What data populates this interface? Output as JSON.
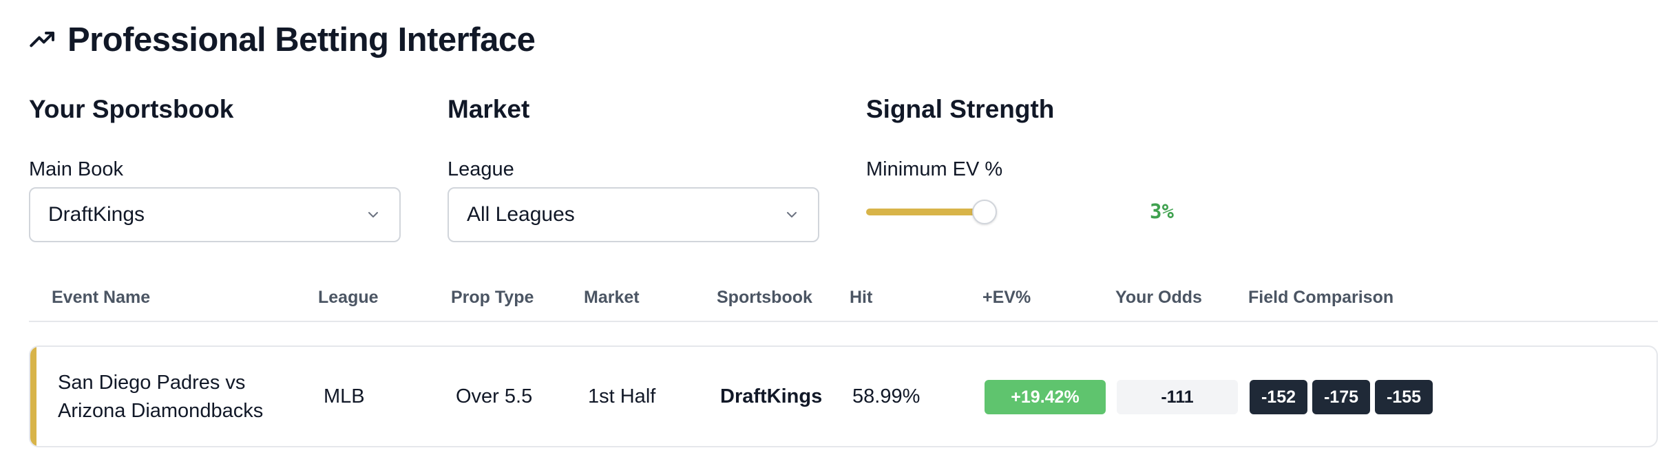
{
  "header": {
    "title": "Professional Betting Interface",
    "icon": "trending-up-icon"
  },
  "sections": {
    "sportsbook": {
      "heading": "Your Sportsbook",
      "label": "Main Book",
      "value": "DraftKings"
    },
    "market": {
      "heading": "Market",
      "label": "League",
      "value": "All Leagues"
    },
    "signal": {
      "heading": "Signal Strength",
      "label": "Minimum EV %",
      "value": "3%",
      "slider_level": 0.3
    }
  },
  "colors": {
    "accent": "#d8b449",
    "ev_positive": "#5fc46e",
    "slider_value": "#3fa14f",
    "chip_dark": "#1f2937"
  },
  "table": {
    "columns": [
      "Event Name",
      "League",
      "Prop Type",
      "Market",
      "Sportsbook",
      "Hit",
      "+EV%",
      "Your Odds",
      "Field Comparison"
    ],
    "rows": [
      {
        "event_line1": "San Diego Padres vs",
        "event_line2": "Arizona Diamondbacks",
        "league": "MLB",
        "prop_type": "Over 5.5",
        "market": "1st Half",
        "sportsbook": "DraftKings",
        "hit": "58.99%",
        "ev": "+19.42%",
        "your_odds": "-111",
        "field": [
          "-152",
          "-175",
          "-155"
        ]
      }
    ]
  }
}
